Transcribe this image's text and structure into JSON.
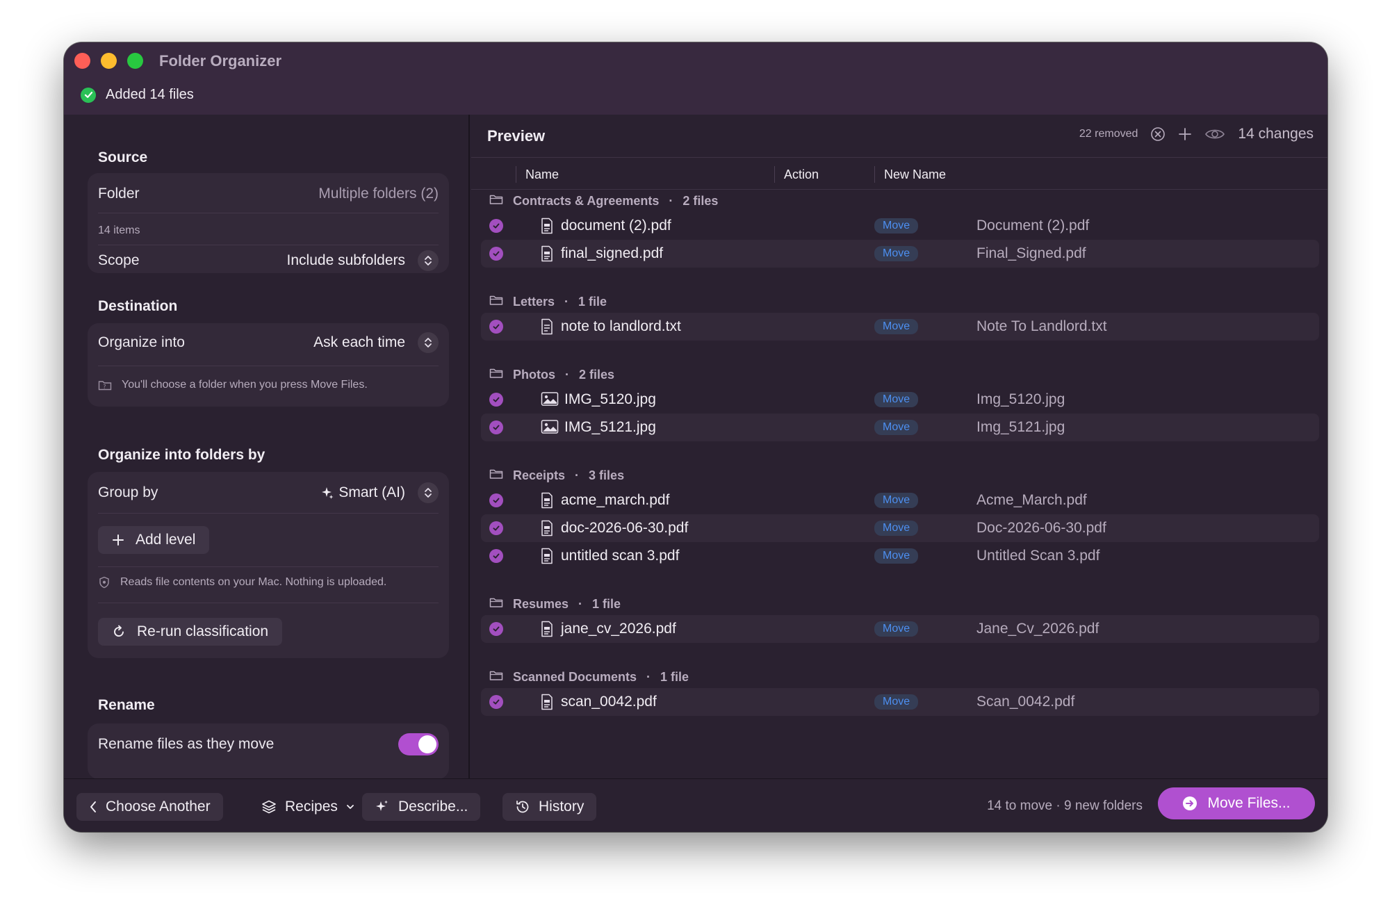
{
  "window": {
    "title": "Folder Organizer",
    "status": "Added 14 files"
  },
  "sidebar": {
    "source": {
      "title": "Source",
      "folder_label": "Folder",
      "folder_value": "Multiple folders (2)",
      "item_count": "14 items",
      "scope_label": "Scope",
      "scope_value": "Include subfolders"
    },
    "destination": {
      "title": "Destination",
      "organize_label": "Organize into",
      "organize_value": "Ask each time",
      "hint": "You'll choose a folder when you press Move Files."
    },
    "grouping": {
      "title": "Organize into folders by",
      "group_label": "Group by",
      "group_value": "Smart (AI)",
      "add_level": "Add level",
      "privacy_note": "Reads file contents on your Mac. Nothing is uploaded.",
      "rerun": "Re-run classification"
    },
    "rename": {
      "title": "Rename",
      "toggle_label": "Rename files as they move",
      "toggle_on": true
    }
  },
  "preview": {
    "title": "Preview",
    "removed": "22 removed",
    "changes": "14 changes",
    "columns": {
      "name": "Name",
      "action": "Action",
      "new_name": "New Name"
    },
    "groups": [
      {
        "name": "Contracts & Agreements",
        "count": "2 files",
        "files": [
          {
            "name": "document (2).pdf",
            "type": "pdf",
            "action": "Move",
            "new_name": "Document (2).pdf"
          },
          {
            "name": "final_signed.pdf",
            "type": "pdf",
            "action": "Move",
            "new_name": "Final_Signed.pdf"
          }
        ]
      },
      {
        "name": "Letters",
        "count": "1 file",
        "files": [
          {
            "name": "note to landlord.txt",
            "type": "txt",
            "action": "Move",
            "new_name": "Note To Landlord.txt"
          }
        ]
      },
      {
        "name": "Photos",
        "count": "2 files",
        "files": [
          {
            "name": "IMG_5120.jpg",
            "type": "img",
            "action": "Move",
            "new_name": "Img_5120.jpg"
          },
          {
            "name": "IMG_5121.jpg",
            "type": "img",
            "action": "Move",
            "new_name": "Img_5121.jpg"
          }
        ]
      },
      {
        "name": "Receipts",
        "count": "3 files",
        "files": [
          {
            "name": "acme_march.pdf",
            "type": "pdf",
            "action": "Move",
            "new_name": "Acme_March.pdf"
          },
          {
            "name": "doc-2026-06-30.pdf",
            "type": "pdf",
            "action": "Move",
            "new_name": "Doc-2026-06-30.pdf"
          },
          {
            "name": "untitled scan 3.pdf",
            "type": "pdf",
            "action": "Move",
            "new_name": "Untitled Scan 3.pdf"
          }
        ]
      },
      {
        "name": "Resumes",
        "count": "1 file",
        "files": [
          {
            "name": "jane_cv_2026.pdf",
            "type": "pdf",
            "action": "Move",
            "new_name": "Jane_Cv_2026.pdf"
          }
        ]
      },
      {
        "name": "Scanned Documents",
        "count": "1 file",
        "files": [
          {
            "name": "scan_0042.pdf",
            "type": "pdf",
            "action": "Move",
            "new_name": "Scan_0042.pdf"
          }
        ]
      }
    ]
  },
  "footer": {
    "choose_another": "Choose Another",
    "recipes": "Recipes",
    "describe": "Describe...",
    "history": "History",
    "summary": "14 to move · 9 new folders",
    "move_files": "Move Files..."
  },
  "colors": {
    "accent": "#b050d0",
    "move_badge_text": "#4d8ff0",
    "status_green": "#2ac056"
  }
}
